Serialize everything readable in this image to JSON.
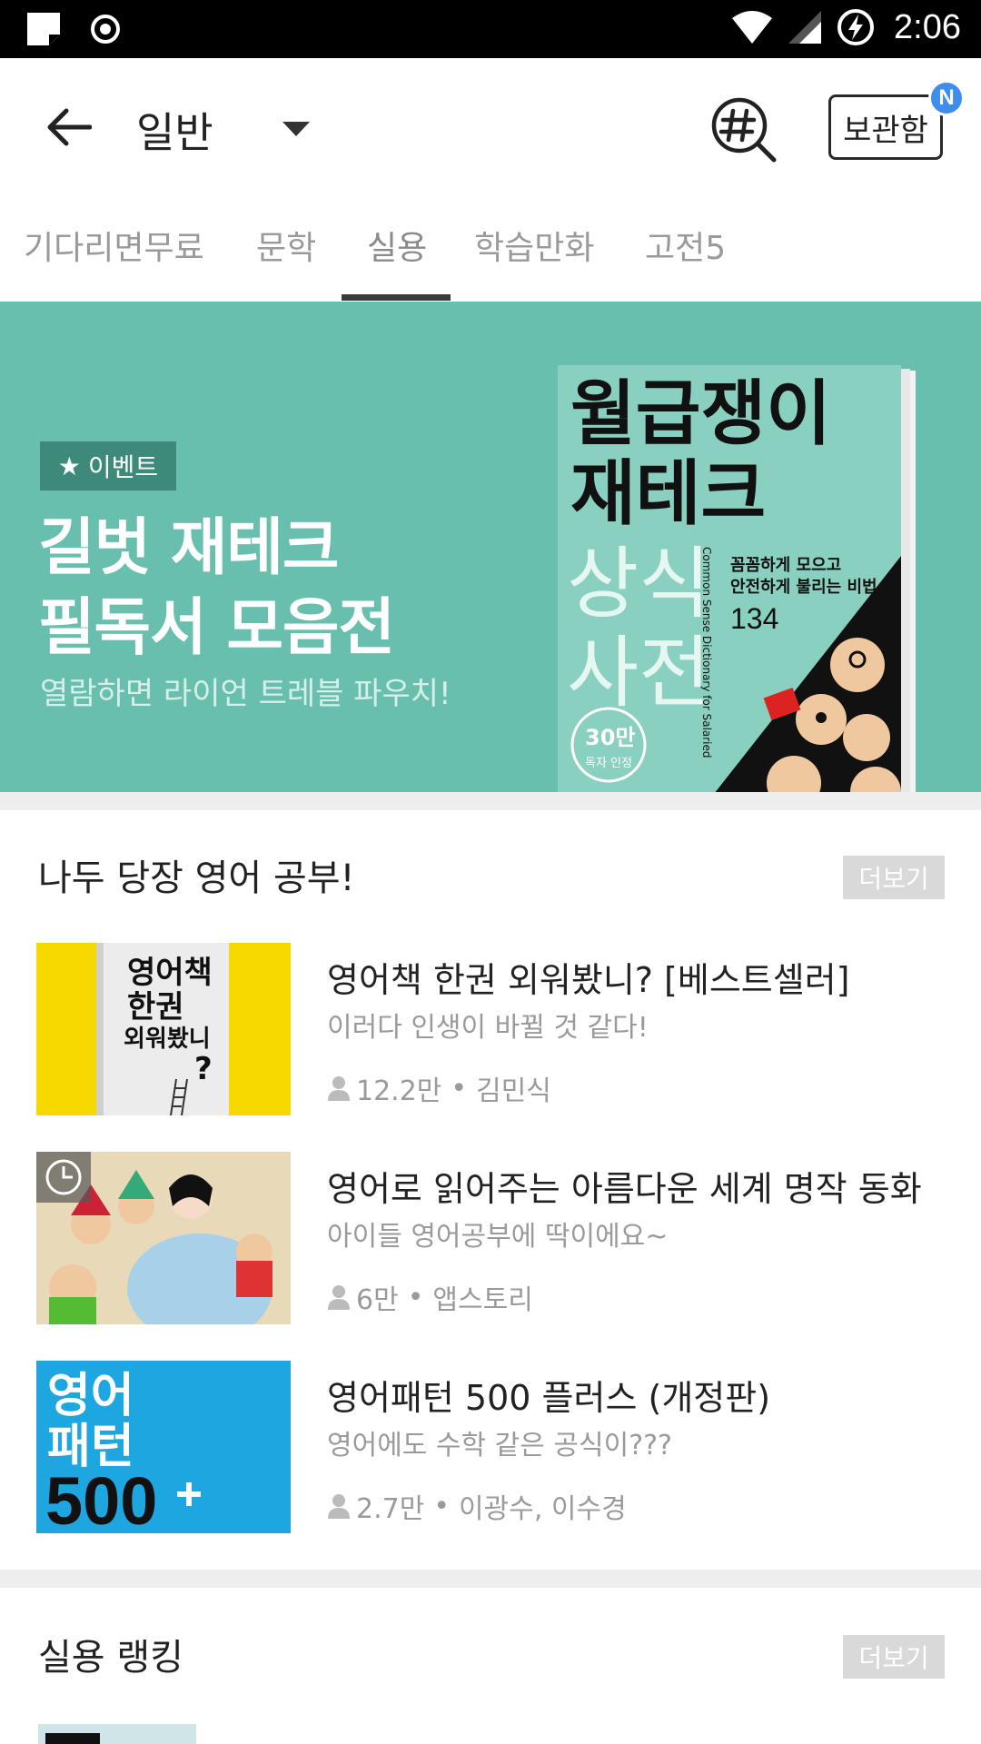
{
  "status_bar": {
    "time": "2:06",
    "icons": [
      "sticky-note-icon",
      "target-icon",
      "wifi-icon",
      "signal-icon",
      "battery-charging-icon"
    ]
  },
  "app_bar": {
    "title": "일반",
    "bookshelf_label": "보관함",
    "badge": "N"
  },
  "tabs": [
    {
      "label": "기다리면무료"
    },
    {
      "label": "문학"
    },
    {
      "label": "실용",
      "active": true
    },
    {
      "label": "학습만화"
    },
    {
      "label": "고전5"
    }
  ],
  "banner": {
    "chip": "이벤트",
    "title_line1": "길벗 재테크",
    "title_line2": "필독서 모음전",
    "subtitle": "열람하면 라이언 트레블 파우치!",
    "book_title1": "월급쟁이",
    "book_title2": "재테크",
    "book_title3": "상식",
    "book_title4": "사전",
    "book_tagline1": "꼼꼼하게 모으고",
    "book_tagline2": "안전하게 불리는 비법",
    "book_number": "134",
    "book_badge1": "30만",
    "book_badge2": "독자 인정",
    "book_vertical": "Common Sense Dictionary for Salaried"
  },
  "section1": {
    "title": "나두 당장 영어 공부!",
    "more": "더보기",
    "items": [
      {
        "title": "영어책 한권 외워봤니? [베스트셀러]",
        "desc": "이러다 인생이 바뀔 것 같다!",
        "readers": "12.2만",
        "author": "김민식",
        "cover_line1": "영어책",
        "cover_line2": "한권",
        "cover_line3": "외워봤니",
        "cover_q": "?"
      },
      {
        "title": "영어로 읽어주는 아름다운 세계 명작 동화",
        "desc": "아이들 영어공부에 딱이에요~",
        "readers": "6만",
        "author": "앱스토리"
      },
      {
        "title": "영어패턴 500 플러스 (개정판)",
        "desc": "영어에도 수학 같은 공식이???",
        "readers": "2.7만",
        "author": "이광수, 이수경",
        "cover_line1": "영어",
        "cover_line2": "패턴",
        "cover_line3": "500"
      }
    ]
  },
  "section2": {
    "title": "실용 랭킹",
    "more": "더보기"
  },
  "colors": {
    "banner_bg": "#68bfae",
    "badge_blue": "#3f8cf0",
    "tab_indicator": "#3a3a3a"
  }
}
